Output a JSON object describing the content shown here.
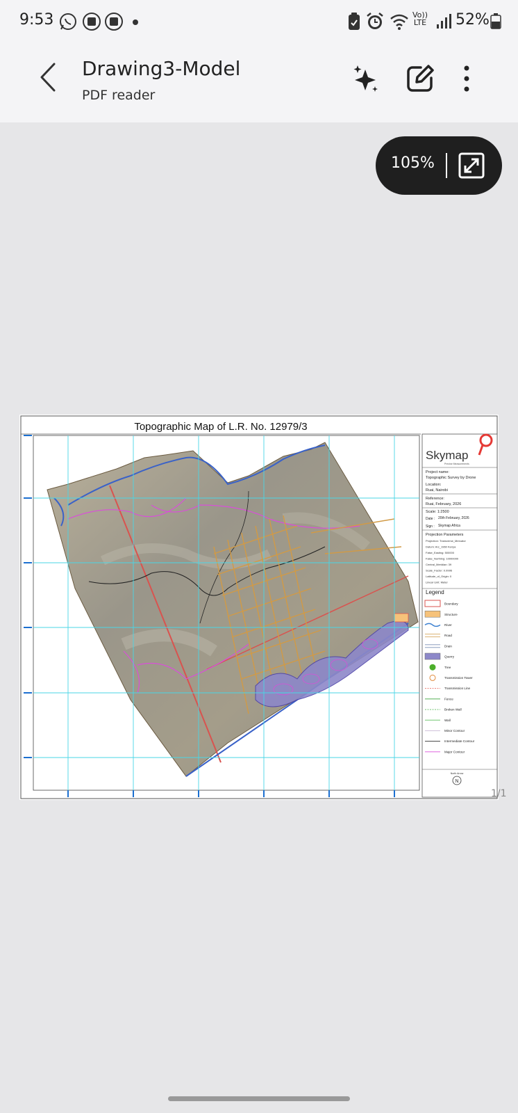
{
  "status_bar": {
    "time": "9:53",
    "network_top": "Vo))",
    "network_bottom": "LTE",
    "battery": "52%",
    "icons": [
      "whatsapp-icon",
      "app-icon",
      "app-icon",
      "dot-icon",
      "clipboard-icon",
      "alarm-icon",
      "wifi-icon",
      "signal-icon",
      "battery-icon"
    ]
  },
  "app_bar": {
    "title": "Drawing3-Model",
    "subtitle": "PDF reader"
  },
  "zoom": {
    "level": "105%"
  },
  "page_counter": "1/1",
  "map": {
    "title": "Topographic Map of L.R. No. 12979/3",
    "company": "Skymap",
    "tagline": "Precise Measurements",
    "project_label": "Project name:",
    "project_value": "Topographic Survey by Drone",
    "location_label": "Location:",
    "location_value": "Ruai, Nairobi",
    "reference_label": "Reference:",
    "reference_value": "Ruai, February, 2026",
    "scale": "Scale: 1:2500",
    "date_label": "Date :",
    "date_value": "20th February, 2026",
    "sign_label": "Sign :",
    "sign_value": "Skymap Africa",
    "projection_heading": "Projection Parameters",
    "projection": [
      "Projection: Transverse_Mercator",
      "Datum: Arc_1960 Kenya",
      "False_Easting: 500000",
      "False_Northing: 10000000",
      "Central_Meridian: 39",
      "Scale_Factor: 0.9996",
      "Latitude_of_Origin: 0",
      "Linear Unit: Meter"
    ],
    "legend_heading": "Legend",
    "legend": [
      {
        "label": "Boundary",
        "sym": "rect-outline",
        "color": "#d9534f"
      },
      {
        "label": "Structure",
        "sym": "rect-fill",
        "color": "#f6c27a"
      },
      {
        "label": "River",
        "sym": "river",
        "color": "#3a7fd0"
      },
      {
        "label": "Road",
        "sym": "double",
        "color": "#d19a46"
      },
      {
        "label": "Drain",
        "sym": "double",
        "color": "#7a8fb5"
      },
      {
        "label": "Querry",
        "sym": "rect-fill",
        "color": "#8d88c9"
      },
      {
        "label": "Tree",
        "sym": "dot",
        "color": "#4caf2a"
      },
      {
        "label": "Transmission Tower",
        "sym": "circle",
        "color": "#e08a3a"
      },
      {
        "label": "Transmission Line",
        "sym": "dash",
        "color": "#e55a4f"
      },
      {
        "label": "Fence",
        "sym": "line",
        "color": "#3da63d"
      },
      {
        "label": "Broken Wall",
        "sym": "dash",
        "color": "#43b043"
      },
      {
        "label": "Wall",
        "sym": "line",
        "color": "#5cbf5c"
      },
      {
        "label": "Minor Contour",
        "sym": "line",
        "color": "#c9b8d6"
      },
      {
        "label": "Intermediate Contour",
        "sym": "line",
        "color": "#333333"
      },
      {
        "label": "Major Contour",
        "sym": "line",
        "color": "#d94fd9"
      }
    ],
    "north_label": "North Arrow",
    "north_letter": "N"
  }
}
